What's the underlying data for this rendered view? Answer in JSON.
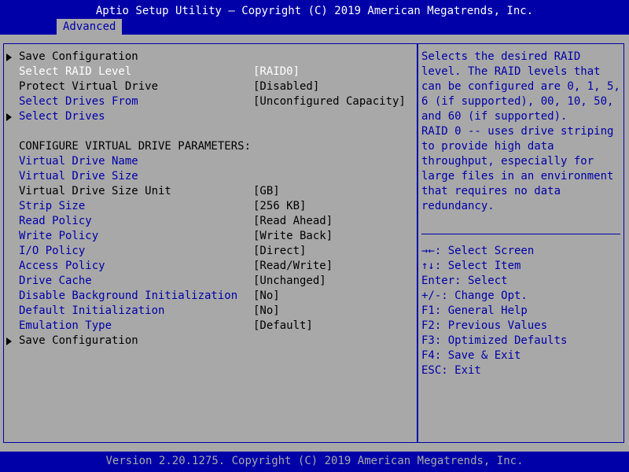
{
  "header": {
    "title": "Aptio Setup Utility – Copyright (C) 2019 American Megatrends, Inc.",
    "tab": "Advanced"
  },
  "menu": {
    "rows": [
      {
        "label": "Save Configuration",
        "value": "",
        "arrow": true,
        "label_color": "black"
      },
      {
        "label": "Select RAID Level",
        "value": "[RAID0]",
        "arrow": false,
        "label_color": "white"
      },
      {
        "label": "Protect Virtual Drive",
        "value": "[Disabled]",
        "arrow": false,
        "label_color": "black"
      },
      {
        "label": "Select Drives From",
        "value": "[Unconfigured Capacity]",
        "arrow": false,
        "label_color": "blue"
      },
      {
        "label": "Select Drives",
        "value": "",
        "arrow": true,
        "label_color": "blue"
      },
      {
        "label": "",
        "value": "",
        "arrow": false,
        "label_color": "black"
      },
      {
        "label": "CONFIGURE VIRTUAL DRIVE PARAMETERS:",
        "value": "",
        "arrow": false,
        "label_color": "black"
      },
      {
        "label": "Virtual Drive Name",
        "value": "",
        "arrow": false,
        "label_color": "blue"
      },
      {
        "label": "Virtual Drive Size",
        "value": "",
        "arrow": false,
        "label_color": "blue"
      },
      {
        "label": "Virtual Drive Size Unit",
        "value": "[GB]",
        "arrow": false,
        "label_color": "black"
      },
      {
        "label": "Strip Size",
        "value": "[256 KB]",
        "arrow": false,
        "label_color": "blue"
      },
      {
        "label": "Read Policy",
        "value": "[Read Ahead]",
        "arrow": false,
        "label_color": "blue"
      },
      {
        "label": "Write Policy",
        "value": "[Write Back]",
        "arrow": false,
        "label_color": "blue"
      },
      {
        "label": "I/O Policy",
        "value": "[Direct]",
        "arrow": false,
        "label_color": "blue"
      },
      {
        "label": "Access Policy",
        "value": "[Read/Write]",
        "arrow": false,
        "label_color": "blue"
      },
      {
        "label": "Drive Cache",
        "value": "[Unchanged]",
        "arrow": false,
        "label_color": "blue"
      },
      {
        "label": "Disable Background Initialization",
        "value": "[No]",
        "arrow": false,
        "label_color": "blue"
      },
      {
        "label": "Default Initialization",
        "value": "[No]",
        "arrow": false,
        "label_color": "blue"
      },
      {
        "label": "Emulation Type",
        "value": "[Default]",
        "arrow": false,
        "label_color": "blue"
      },
      {
        "label": "Save Configuration",
        "value": "",
        "arrow": true,
        "label_color": "black"
      }
    ]
  },
  "help": {
    "lines": [
      "Selects the desired RAID",
      "level. The RAID levels that",
      "can be configured are 0, 1, 5,",
      "6 (if supported), 00, 10, 50,",
      "and 60 (if supported).",
      "RAID 0 -- uses drive striping",
      "to provide high data",
      "throughput, especially for",
      "large files in an environment",
      "that requires no data",
      "redundancy."
    ]
  },
  "keys": {
    "lines": [
      "→←: Select Screen",
      "↑↓: Select Item",
      "Enter: Select",
      "+/-: Change Opt.",
      "F1: General Help",
      "F2: Previous Values",
      "F3: Optimized Defaults",
      "F4: Save & Exit",
      "ESC: Exit"
    ]
  },
  "footer": {
    "text": "Version 2.20.1275. Copyright (C) 2019 American Megatrends, Inc."
  },
  "colors": {
    "background_blue": "#0000a8",
    "panel_gray": "#a8a8a8",
    "selected_white": "#ffffff"
  }
}
